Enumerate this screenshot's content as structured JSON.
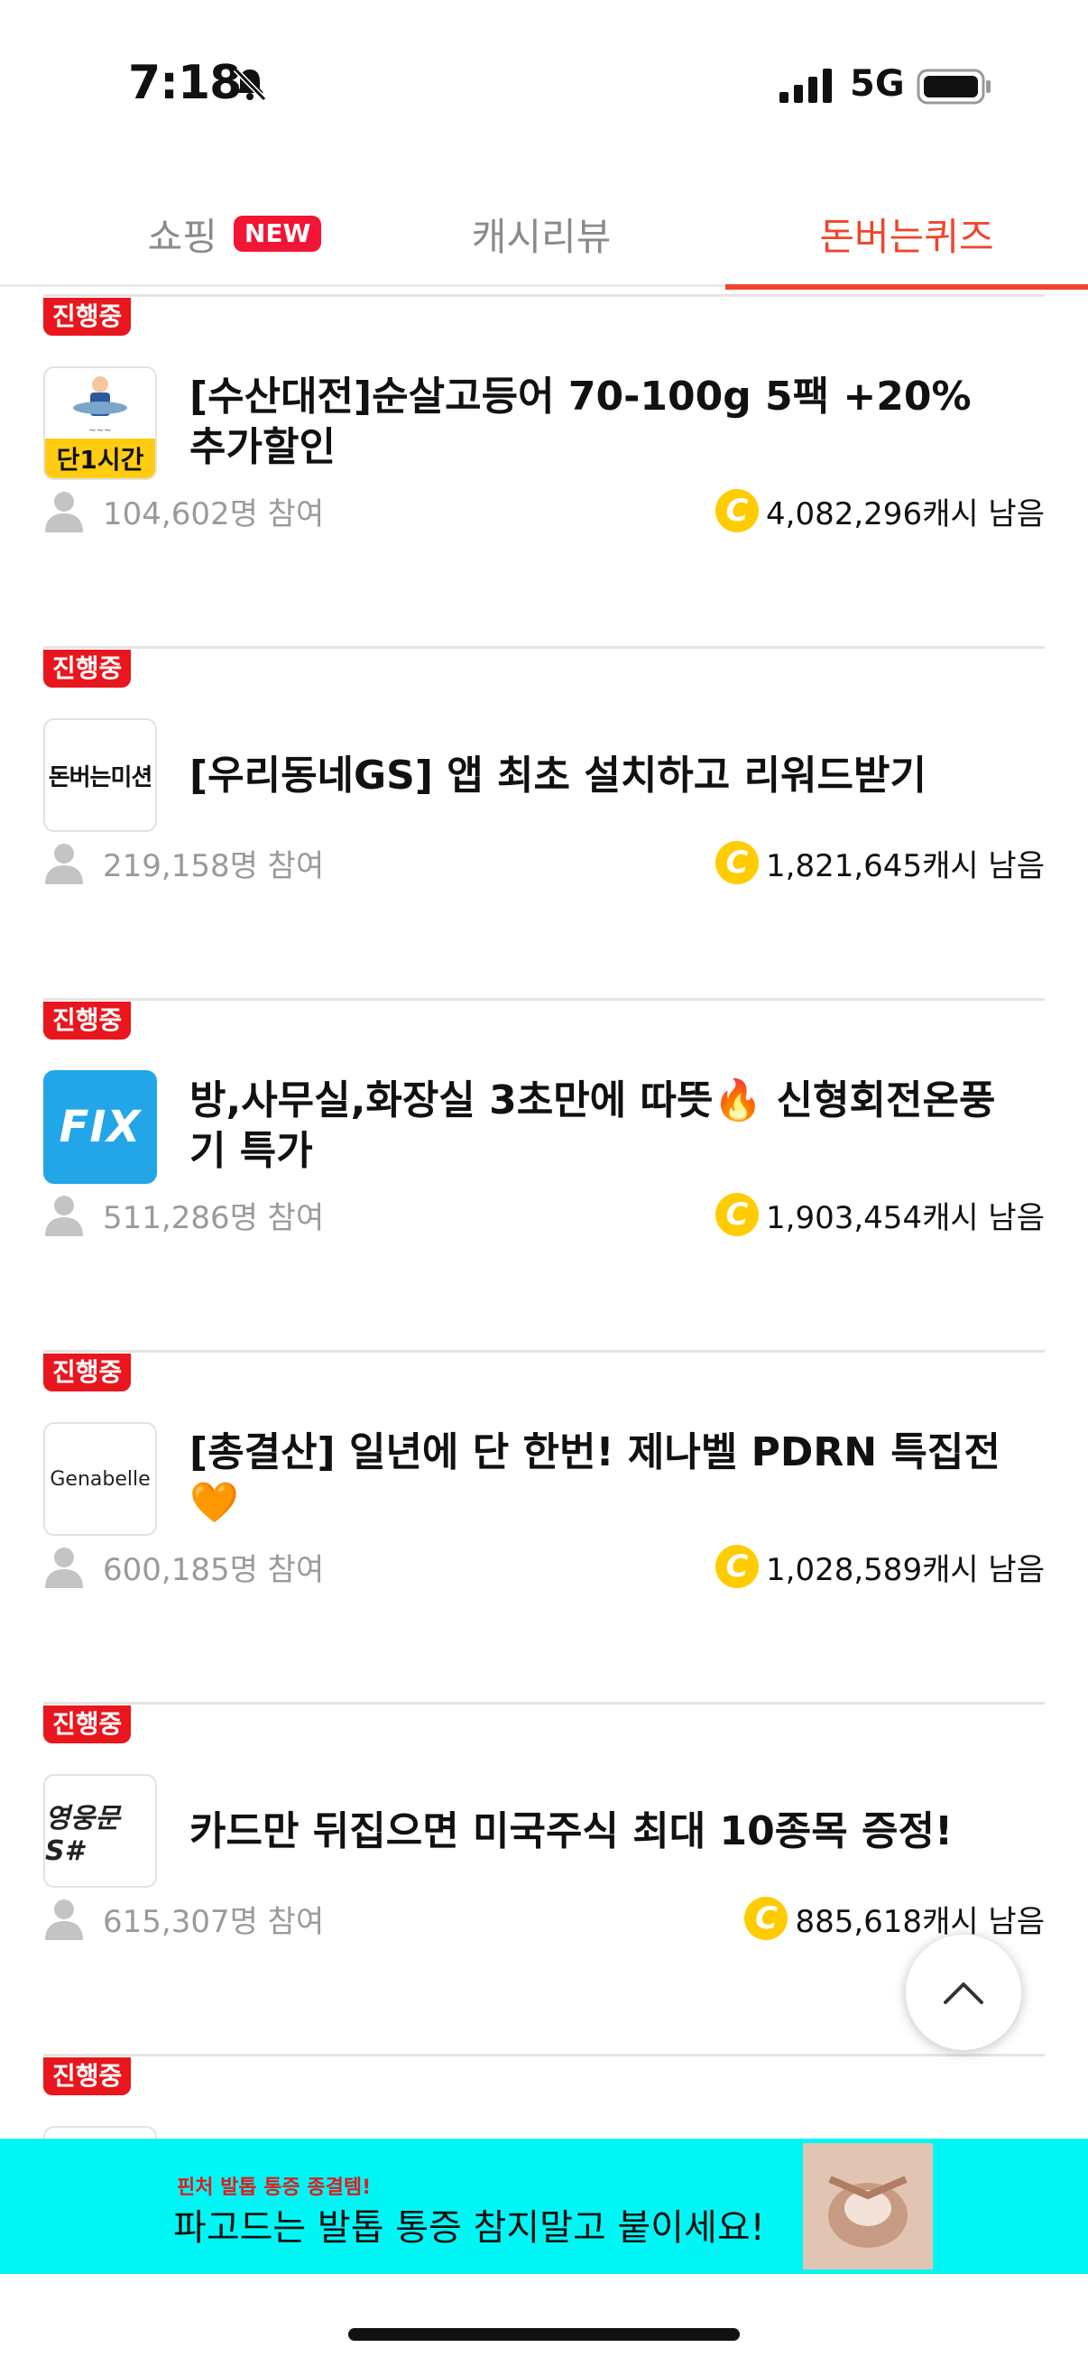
{
  "status_bar": {
    "time": "7:18",
    "network": "5G"
  },
  "tabs": [
    {
      "label": "쇼핑",
      "badge": "NEW"
    },
    {
      "label": "캐시리뷰"
    },
    {
      "label": "돈버는퀴즈",
      "active": true
    }
  ],
  "status_label": "진행중",
  "items": [
    {
      "title": "[수산대전]순살고등어 70-100g 5팩 +20%추가할인",
      "participants": "104,602명 참여",
      "remaining": "4,082,296캐시 남음",
      "thumb_text": "단1시간"
    },
    {
      "title": "[우리동네GS] 앱 최초 설치하고 리워드받기",
      "participants": "219,158명 참여",
      "remaining": "1,821,645캐시 남음",
      "thumb_text": "돈버는미션"
    },
    {
      "title": "방,사무실,화장실 3초만에 따뜻🔥 신형회전온풍기 특가",
      "participants": "511,286명 참여",
      "remaining": "1,903,454캐시 남음",
      "thumb_text": "FIX"
    },
    {
      "title": "[총결산] 일년에 단 한번! 제나벨 PDRN 특집전 🧡",
      "participants": "600,185명 참여",
      "remaining": "1,028,589캐시 남음",
      "thumb_text": "Genabelle"
    },
    {
      "title": "카드만 뒤집으면 미국주식 최대 10종목 증정!",
      "participants": "615,307명 참여",
      "remaining": "885,618캐시 남음",
      "thumb_text": "영웅문S#"
    }
  ],
  "coin_symbol": "C",
  "ad": {
    "small_text": "핀처 발톱 통증 종결템!",
    "main_text": "파고드는 발톱 통증 참지말고 붙이세요!"
  },
  "colors": {
    "accent": "#f0452b",
    "badge": "#e8161d",
    "coin": "#ffcc00",
    "ad_bg": "#00f6f4"
  }
}
